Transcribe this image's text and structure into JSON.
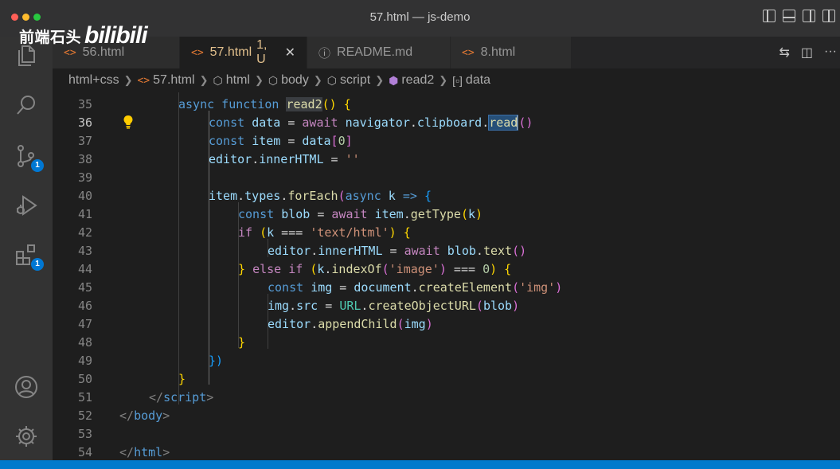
{
  "window": {
    "title": "57.html — js-demo"
  },
  "watermark": {
    "text": "前端石头",
    "logo": "bilibili"
  },
  "activity_bar": {
    "items": [
      {
        "name": "explorer",
        "icon": "files-icon"
      },
      {
        "name": "search",
        "icon": "search-icon"
      },
      {
        "name": "source-control",
        "icon": "source-control-icon",
        "badge": "1"
      },
      {
        "name": "run-debug",
        "icon": "debug-icon"
      },
      {
        "name": "extensions",
        "icon": "extensions-icon",
        "badge": "1"
      },
      {
        "name": "accounts",
        "icon": "account-icon"
      },
      {
        "name": "manage",
        "icon": "gear-icon"
      }
    ]
  },
  "tabs": [
    {
      "label": "56.html",
      "icon": "<>"
    },
    {
      "label": "57.html",
      "icon": "<>",
      "status": "1, U",
      "close": "✕"
    },
    {
      "label": "README.md",
      "icon": "ⓘ"
    },
    {
      "label": "8.html",
      "icon": "<>"
    }
  ],
  "breadcrumb": [
    "html+css",
    "57.html",
    "html",
    "body",
    "script",
    "read2",
    "data"
  ],
  "editor": {
    "line_numbers": [
      "35",
      "36",
      "37",
      "38",
      "39",
      "40",
      "41",
      "42",
      "43",
      "44",
      "45",
      "46",
      "47",
      "48",
      "49",
      "50",
      "51",
      "52",
      "53",
      "54"
    ],
    "current_line": "36",
    "lines": [
      [
        "async function ",
        "read2",
        "() {"
      ],
      [
        "const ",
        "data",
        " = ",
        "await ",
        "navigator",
        ".",
        "clipboard",
        ".",
        "read",
        "()"
      ],
      [
        "const ",
        "item",
        " = ",
        "data",
        "[",
        "0",
        "]"
      ],
      [
        "editor",
        ".",
        "innerHTML",
        " = ",
        "''"
      ],
      [
        ""
      ],
      [
        "item",
        ".",
        "types",
        ".",
        "forEach",
        "(",
        "async ",
        "k",
        " => ",
        "{"
      ],
      [
        "const ",
        "blob",
        " = ",
        "await ",
        "item",
        ".",
        "getType",
        "(",
        "k",
        ")"
      ],
      [
        "if ",
        "(",
        "k",
        " === ",
        "'text/html'",
        ") ",
        "{"
      ],
      [
        "editor",
        ".",
        "innerHTML",
        " = ",
        "await ",
        "blob",
        ".",
        "text",
        "()"
      ],
      [
        "} ",
        "else ",
        "if ",
        "(",
        "k",
        ".",
        "indexOf",
        "(",
        "'image'",
        ")",
        " === ",
        "0",
        ") ",
        "{"
      ],
      [
        "const ",
        "img",
        " = ",
        "document",
        ".",
        "createElement",
        "(",
        "'img'",
        ")"
      ],
      [
        "img",
        ".",
        "src",
        " = ",
        "URL",
        ".",
        "createObjectURL",
        "(",
        "blob",
        ")"
      ],
      [
        "editor",
        ".",
        "appendChild",
        "(",
        "img",
        ")"
      ],
      [
        "}"
      ],
      [
        "})"
      ],
      [
        "}"
      ],
      [
        "</",
        "script",
        ">"
      ],
      [
        "</",
        "body",
        ">"
      ],
      [
        ""
      ],
      [
        "</",
        "html",
        ">"
      ]
    ]
  },
  "colors": {
    "accent": "#007acc",
    "badge": "#0078d4",
    "modified_tab": "#e2c08d",
    "html_icon": "#e37933"
  }
}
